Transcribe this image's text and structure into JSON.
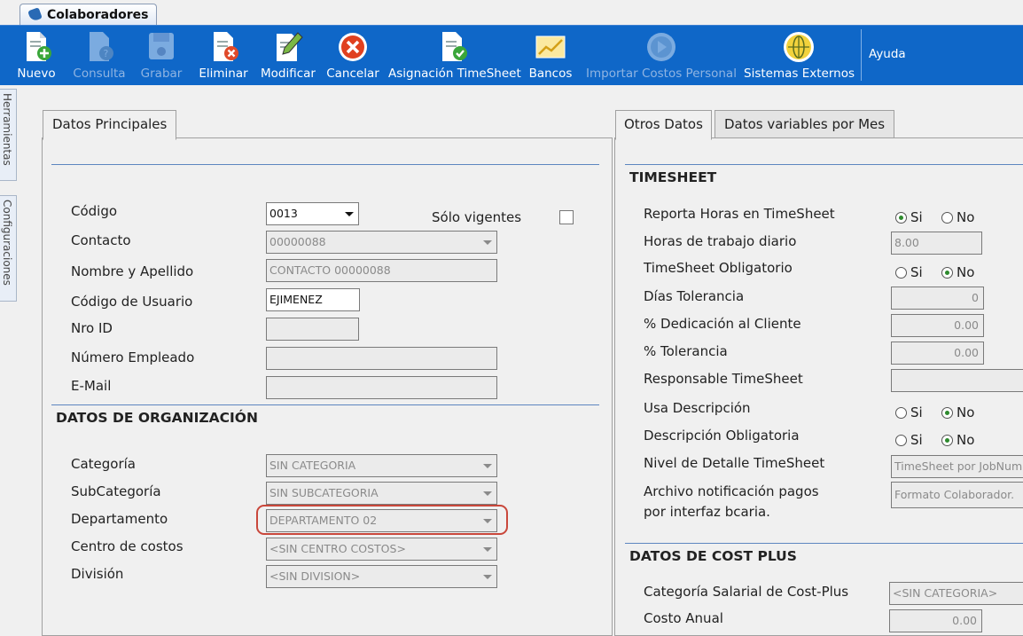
{
  "window_tab": "Colaboradores",
  "toolbar": {
    "nuevo": "Nuevo",
    "consulta": "Consulta",
    "grabar": "Grabar",
    "eliminar": "Eliminar",
    "modificar": "Modificar",
    "cancelar": "Cancelar",
    "asignacion": "Asignación TimeSheet",
    "bancos": "Bancos",
    "importar": "Importar Costos Personal",
    "sistemas": "Sistemas Externos",
    "ayuda": "Ayuda"
  },
  "side_tabs": {
    "herramientas": "Herramientas",
    "configuraciones": "Configuraciones"
  },
  "left": {
    "tab": "Datos Principales",
    "codigo_label": "Código",
    "codigo_value": "0013",
    "solo_vigentes_label": "Sólo vigentes",
    "contacto_label": "Contacto",
    "contacto_value": "00000088",
    "nombre_label": "Nombre y Apellido",
    "nombre_value": "CONTACTO 00000088",
    "usuario_label": "Código de Usuario",
    "usuario_value": "EJIMENEZ",
    "nroid_label": "Nro ID",
    "nroid_value": "",
    "empleado_label": "Número Empleado",
    "empleado_value": "",
    "email_label": "E-Mail",
    "email_value": "",
    "org_section": "DATOS DE ORGANIZACIÓN",
    "categoria_label": "Categoría",
    "categoria_value": "SIN CATEGORIA",
    "subcategoria_label": "SubCategoría",
    "subcategoria_value": "SIN SUBCATEGORIA",
    "departamento_label": "Departamento",
    "departamento_value": "DEPARTAMENTO 02",
    "centro_label": "Centro de costos",
    "centro_value": "<SIN CENTRO COSTOS>",
    "division_label": "División",
    "division_value": "<SIN DIVISION>"
  },
  "right": {
    "tab_otros": "Otros Datos",
    "tab_variables": "Datos variables por Mes",
    "timesheet_section": "TIMESHEET",
    "reporta_label": "Reporta Horas en TimeSheet",
    "horas_label": "Horas de trabajo diario",
    "horas_value": "8.00",
    "obligatorio_label": "TimeSheet Obligatorio",
    "dias_label": "Días Tolerancia",
    "dias_value": "0",
    "dedicacion_label": "% Dedicación al Cliente",
    "dedicacion_value": "0.00",
    "tolerancia_label": "% Tolerancia",
    "tolerancia_value": "0.00",
    "responsable_label": "Responsable TimeSheet",
    "responsable_value": "",
    "usa_desc_label": "Usa Descripción",
    "desc_oblig_label": "Descripción Obligatoria",
    "nivel_label": "Nivel de Detalle TimeSheet",
    "nivel_value": "TimeSheet por JobNum",
    "archivo_label_1": "Archivo notificación pagos",
    "archivo_label_2": "por interfaz bcaria.",
    "archivo_value": "Formato Colaborador.",
    "si": "Si",
    "no": "No",
    "cost_section": "DATOS DE COST PLUS",
    "cat_salarial_label": "Categoría Salarial de Cost-Plus",
    "cat_salarial_value": "<SIN CATEGORIA>",
    "costo_anual_label": "Costo Anual",
    "costo_anual_value": "0.00"
  },
  "colors": {
    "toolbar": "#0f67c8",
    "highlight": "#c9473b",
    "section_line": "#5d86c0"
  }
}
